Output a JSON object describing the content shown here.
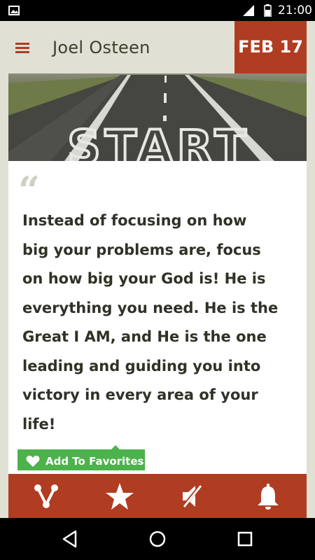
{
  "status_bar": {
    "time": "21:00",
    "icons": [
      "gallery-icon",
      "signal-icon",
      "battery-icon"
    ]
  },
  "app_bar": {
    "title": "Joel Osteen",
    "date": "FEB 17",
    "menu_icon": "hamburger-menu-icon"
  },
  "quote": {
    "hero_image_text": "START",
    "lines": [
      "Instead of focusing on how",
      "big your problems are, focus",
      "on how big your God is! He is",
      "everything you need. He is the",
      "Great I AM, and He is the one",
      "leading and guiding you into",
      "victory in every area of your",
      "life!"
    ]
  },
  "favorites": {
    "label": "Add To Favorites",
    "icon": "heart-icon"
  },
  "toolbar": {
    "icons": [
      "share-icon",
      "star-icon",
      "mute-icon",
      "bell-icon"
    ]
  },
  "nav": {
    "icons": [
      "back-icon",
      "home-icon",
      "recents-icon"
    ]
  },
  "colors": {
    "accent": "#b03c22",
    "background": "#e1e0d4",
    "favorite": "#4cb24b",
    "text": "#303227"
  }
}
